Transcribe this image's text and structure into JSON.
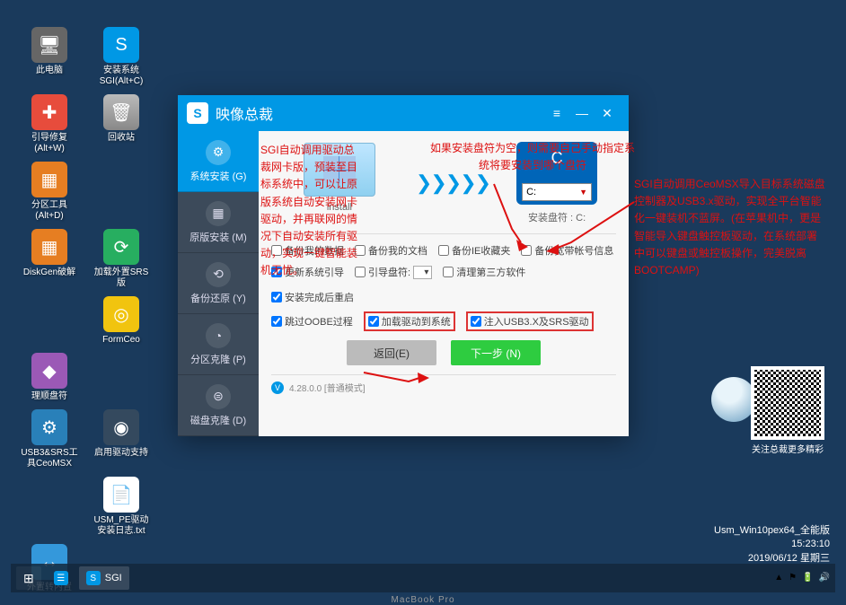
{
  "desktop": {
    "icons": [
      {
        "label": "此电脑",
        "cls": "ico-pc",
        "glyph": "🖥"
      },
      {
        "label": "安装系统\nSGI(Alt+C)",
        "cls": "ico-sgi",
        "glyph": "S"
      },
      {
        "label": "引导修复\n(Alt+W)",
        "cls": "ico-boot",
        "glyph": "✚"
      },
      {
        "label": "回收站",
        "cls": "ico-trash",
        "glyph": "🗑"
      },
      {
        "label": "分区工具\n(Alt+D)",
        "cls": "ico-part",
        "glyph": "▦"
      },
      {
        "label": "",
        "cls": "",
        "glyph": ""
      },
      {
        "label": "DiskGen破解",
        "cls": "ico-disk",
        "glyph": "▦"
      },
      {
        "label": "加载外置SRS\n版",
        "cls": "ico-srs",
        "glyph": "⟳"
      },
      {
        "label": "",
        "cls": "",
        "glyph": ""
      },
      {
        "label": "FormCeo",
        "cls": "ico-form",
        "glyph": "◎"
      },
      {
        "label": "理顺盘符",
        "cls": "ico-tidy",
        "glyph": "◆"
      },
      {
        "label": "",
        "cls": "",
        "glyph": ""
      },
      {
        "label": "USB3&SRS工\n具CeoMSX",
        "cls": "ico-usb3",
        "glyph": "⚙"
      },
      {
        "label": "启用驱动支持",
        "cls": "ico-drv",
        "glyph": "◉"
      },
      {
        "label": "",
        "cls": "",
        "glyph": ""
      },
      {
        "label": "USM_PE驱动\n安装日志.txt",
        "cls": "ico-txt",
        "glyph": "📄"
      },
      {
        "label": "外置转内置",
        "cls": "ico-ext",
        "glyph": "↔"
      }
    ]
  },
  "window": {
    "title": "映像总裁",
    "minimize": "—",
    "close": "✕",
    "menu": "≡"
  },
  "sidebar": {
    "items": [
      {
        "label": "系统安装 (G)",
        "glyph": "⚙",
        "active": true
      },
      {
        "label": "原版安装 (M)",
        "glyph": "▦",
        "active": false
      },
      {
        "label": "备份还原 (Y)",
        "glyph": "⟲",
        "active": false
      },
      {
        "label": "分区克隆 (P)",
        "glyph": "◔",
        "active": false
      },
      {
        "label": "磁盘克隆 (D)",
        "glyph": "⊜",
        "active": false
      }
    ]
  },
  "install": {
    "source_label": "install",
    "arrows": "❯❯❯❯❯",
    "target_letter": "C",
    "drive_value": "C:",
    "target_label": "安装盘符 : C:"
  },
  "options": {
    "row1": [
      {
        "label": "备份我的数据",
        "checked": false
      },
      {
        "label": "备份我的文档",
        "checked": false
      },
      {
        "label": "备份IE收藏夹",
        "checked": false
      },
      {
        "label": "备份宽带帐号信息",
        "checked": false
      }
    ],
    "row2": [
      {
        "label": "更新系统引导",
        "checked": true
      },
      {
        "label": "引导盘符:",
        "sel": "",
        "checked": false,
        "is_select": true
      },
      {
        "label": "清理第三方软件",
        "checked": false
      },
      {
        "label": "安装完成后重启",
        "checked": true
      }
    ],
    "row3": [
      {
        "label": "跳过OOBE过程",
        "checked": true
      },
      {
        "label": "加载驱动到系统",
        "checked": true,
        "hl": true
      },
      {
        "label": "注入USB3.X及SRS驱动",
        "checked": true,
        "hl": true
      }
    ]
  },
  "buttons": {
    "back": "返回(E)",
    "next": "下一步 (N)"
  },
  "footer": {
    "version": "4.28.0.0 [普通模式]"
  },
  "annotations": {
    "left": "SGI自动调用驱动总裁网卡版，预装至目标系统中，可以让原版系统自动安装网卡驱动，并再联网的情况下自动安装所有驱动，实现一键智能装机无忧。",
    "top": "如果安装盘符为空，则需要自己手动指定系统将要安装到哪个盘符",
    "right": "SGI自动调用CeoMSX导入目标系统磁盘控制器及USB3.x驱动，实现全平台智能化一键装机不蓝屏。(在苹果机中，更是智能导入键盘触控板驱动，在系统部署中可以键盘或触控板操作，完美脱离BOOTCAMP)"
  },
  "qr": {
    "label": "关注总裁更多精彩"
  },
  "tray": {
    "line1": "Usm_Win10pex64_全能版",
    "time": "15:23:10",
    "date": "2019/06/12 星期三",
    "icons": [
      "▲",
      "⚑",
      "🔋",
      "🔊"
    ]
  },
  "taskbar": {
    "start": "⊞",
    "apps": [
      {
        "label": "",
        "glyph": "☰"
      },
      {
        "label": "SGI",
        "glyph": "S"
      }
    ]
  },
  "macbook": "MacBook Pro"
}
